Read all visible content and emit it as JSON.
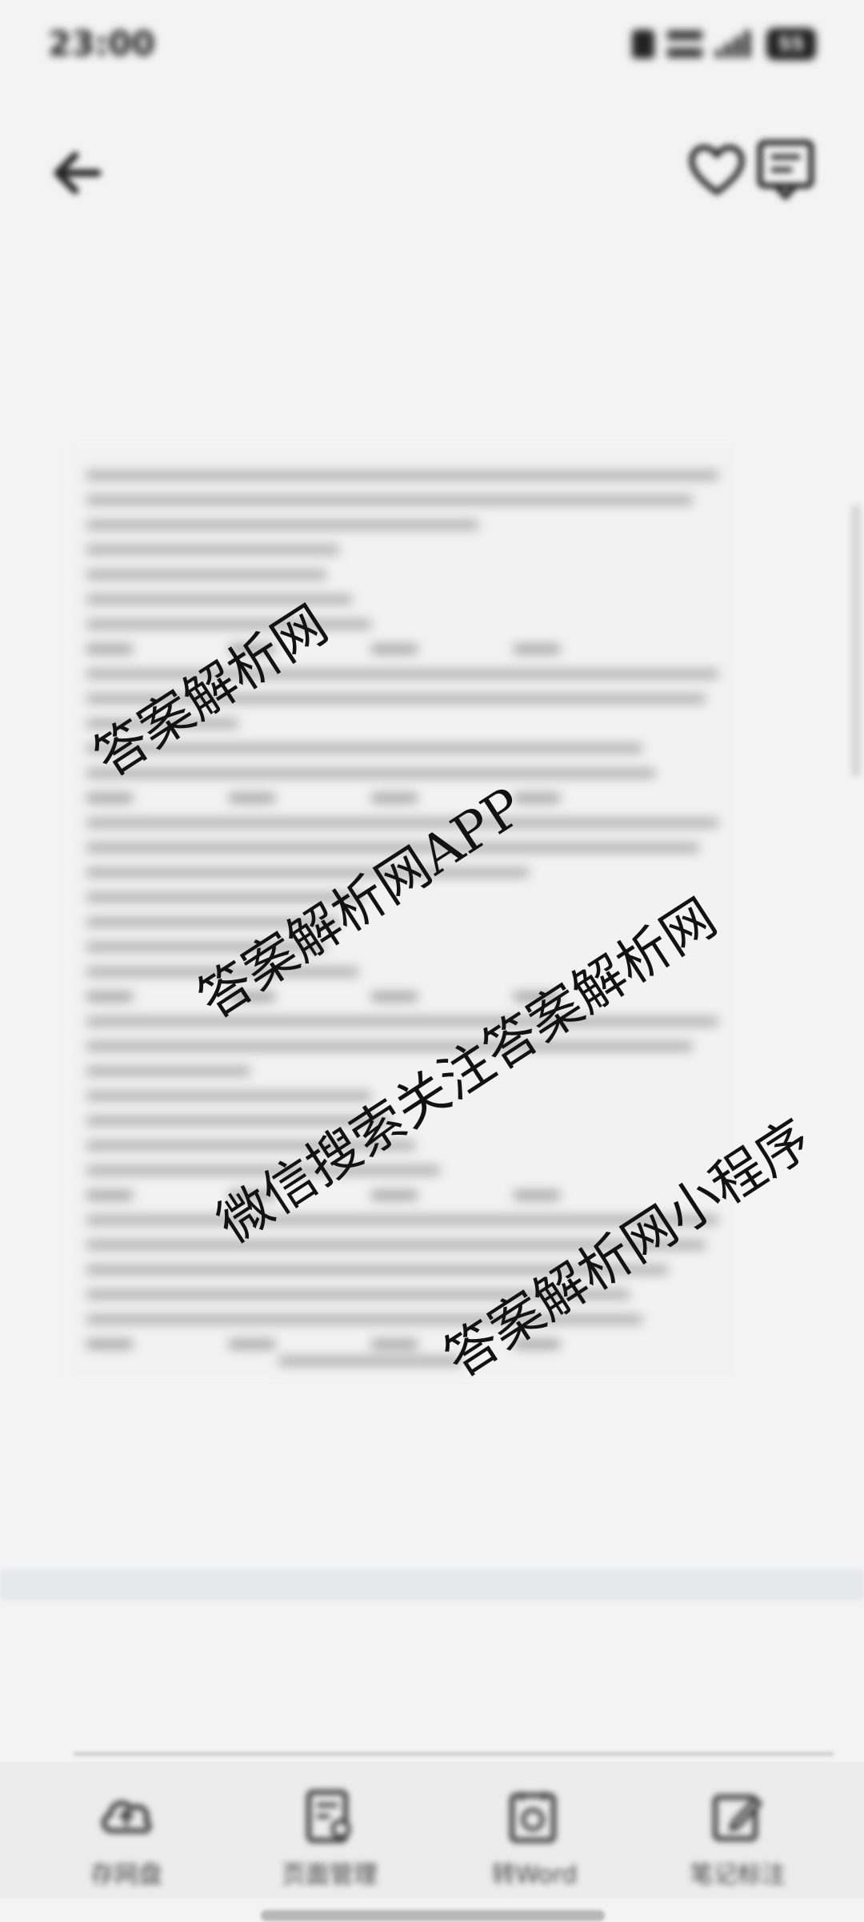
{
  "status_bar": {
    "time": "23:00",
    "battery": "55"
  },
  "toolbar": {
    "back_icon": "back-arrow-icon",
    "favorite_icon": "heart-icon",
    "comment_icon": "comment-icon"
  },
  "watermarks": [
    "答案解析网",
    "答案解析网APP",
    "微信搜索关注答案解析网",
    "答案解析网小程序"
  ],
  "bottom_nav": {
    "items": [
      {
        "label": "存网盘",
        "icon": "cloud-icon"
      },
      {
        "label": "页面管理",
        "icon": "page-manage-icon"
      },
      {
        "label": "转Word",
        "icon": "convert-word-icon"
      },
      {
        "label": "笔记标注",
        "icon": "edit-note-icon"
      }
    ]
  }
}
